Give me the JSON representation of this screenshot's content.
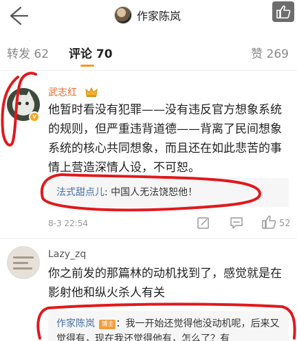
{
  "header": {
    "title": "作家陈岚"
  },
  "tabs": {
    "repost_label": "转发",
    "repost_count": "62",
    "comment_label": "评论",
    "comment_count": "70",
    "like_label": "赞",
    "like_count": "269"
  },
  "comments": [
    {
      "name": "武志红",
      "text": "他暂时看没有犯罪——没有违反官方想象系统的规则，但严重违背道德——背离了民间想象系统的核心共同想象，而且还在如此悲苦的事情上营造深情人设，不可恕。",
      "reply_name": "法式甜点儿",
      "reply_text": ": 中国人无法饶恕他！",
      "time": "8-3 22:54",
      "likes": "52"
    },
    {
      "name": "Lazy_zq",
      "text": "你之前发的那篇林的动机找到了，感觉就是在影射他和纵火杀人有关",
      "reply_name": "作家陈岚",
      "reply_badge": "博主",
      "reply_text": "：我一开始还觉得他没动机呢，后来又觉得有，现在我还觉得他有，怎么了？有"
    }
  ],
  "colors": {
    "accent": "#f59a16",
    "name_highlight": "#e8682b",
    "reply_link": "#4a6fa5",
    "annotation_red": "#e0191c"
  }
}
